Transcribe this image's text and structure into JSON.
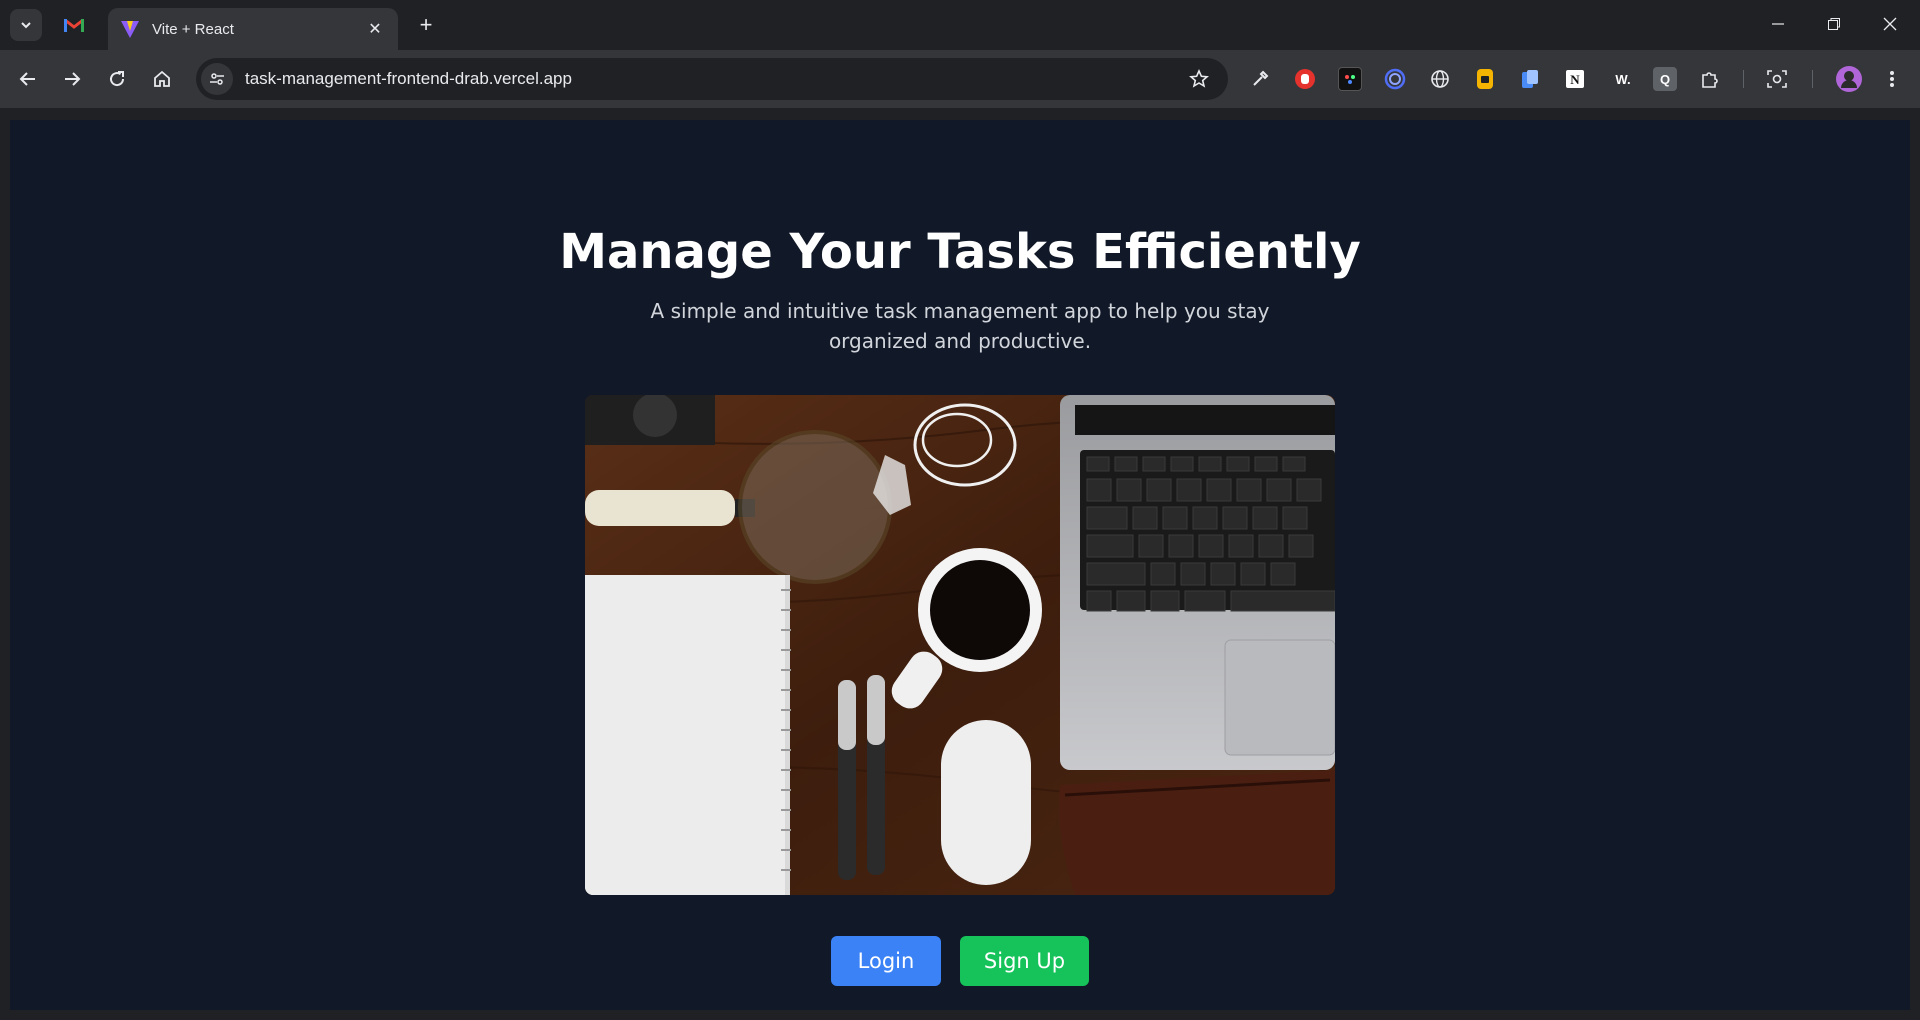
{
  "browser": {
    "tab": {
      "title": "Vite + React"
    },
    "new_tab_symbol": "+",
    "close_symbol": "✕",
    "url": "task-management-frontend-drab.vercel.app",
    "extensions": [
      {
        "name": "eyedropper-icon"
      },
      {
        "name": "hand-icon",
        "color": "#e5322d"
      },
      {
        "name": "colorzilla-icon"
      },
      {
        "name": "spiral-icon",
        "color": "#4f6df5"
      },
      {
        "name": "globe-icon"
      },
      {
        "name": "yellow-ext-icon",
        "color": "#f5b400"
      },
      {
        "name": "docs-icon",
        "color": "#4a8cf7"
      },
      {
        "name": "notion-icon"
      },
      {
        "name": "wikipedia-icon",
        "label": "W."
      },
      {
        "name": "q-ext-icon",
        "label": "Q"
      },
      {
        "name": "extensions-puzzle-icon"
      }
    ]
  },
  "hero": {
    "title": "Manage Your Tasks Efficiently",
    "subtitle": "A simple and intuitive task management app to help you stay organized and productive.",
    "image_alt": "Desk with laptop, coffee, notebook and pens"
  },
  "actions": {
    "login_label": "Login",
    "signup_label": "Sign Up"
  },
  "colors": {
    "page_bg": "#111827",
    "login": "#3b82f6",
    "signup": "#16c35a"
  }
}
